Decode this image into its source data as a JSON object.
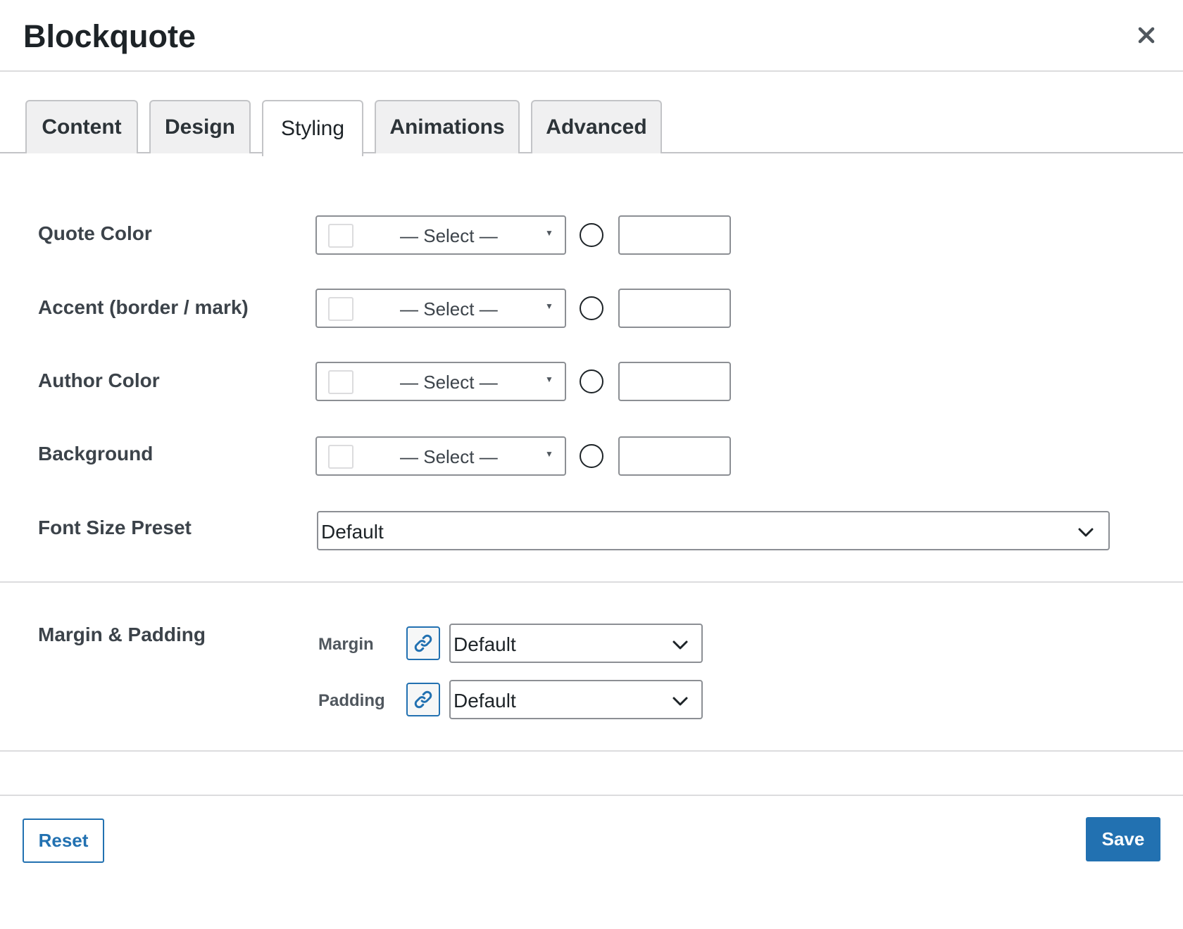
{
  "dialog": {
    "title": "Blockquote",
    "close_icon": "close-icon"
  },
  "tabs": [
    {
      "label": "Content",
      "active": false
    },
    {
      "label": "Design",
      "active": false
    },
    {
      "label": "Styling",
      "active": true
    },
    {
      "label": "Animations",
      "active": false
    },
    {
      "label": "Advanced",
      "active": false
    }
  ],
  "styling": {
    "color_rows": [
      {
        "label": "Quote Color",
        "select_text": "— Select —",
        "hex_value": ""
      },
      {
        "label": "Accent (border / mark)",
        "select_text": "— Select —",
        "hex_value": ""
      },
      {
        "label": "Author Color",
        "select_text": "— Select —",
        "hex_value": ""
      },
      {
        "label": "Background",
        "select_text": "— Select —",
        "hex_value": ""
      }
    ],
    "font_size": {
      "label": "Font Size Preset",
      "value": "Default"
    },
    "spacing": {
      "label": "Margin & Padding",
      "margin": {
        "label": "Margin",
        "value": "Default"
      },
      "padding": {
        "label": "Padding",
        "value": "Default"
      }
    }
  },
  "footer": {
    "reset_label": "Reset",
    "save_label": "Save"
  },
  "colors": {
    "accent": "#2271b1",
    "text": "#1d2327",
    "border": "#8c8f94",
    "tab_bg": "#f0f0f1"
  }
}
